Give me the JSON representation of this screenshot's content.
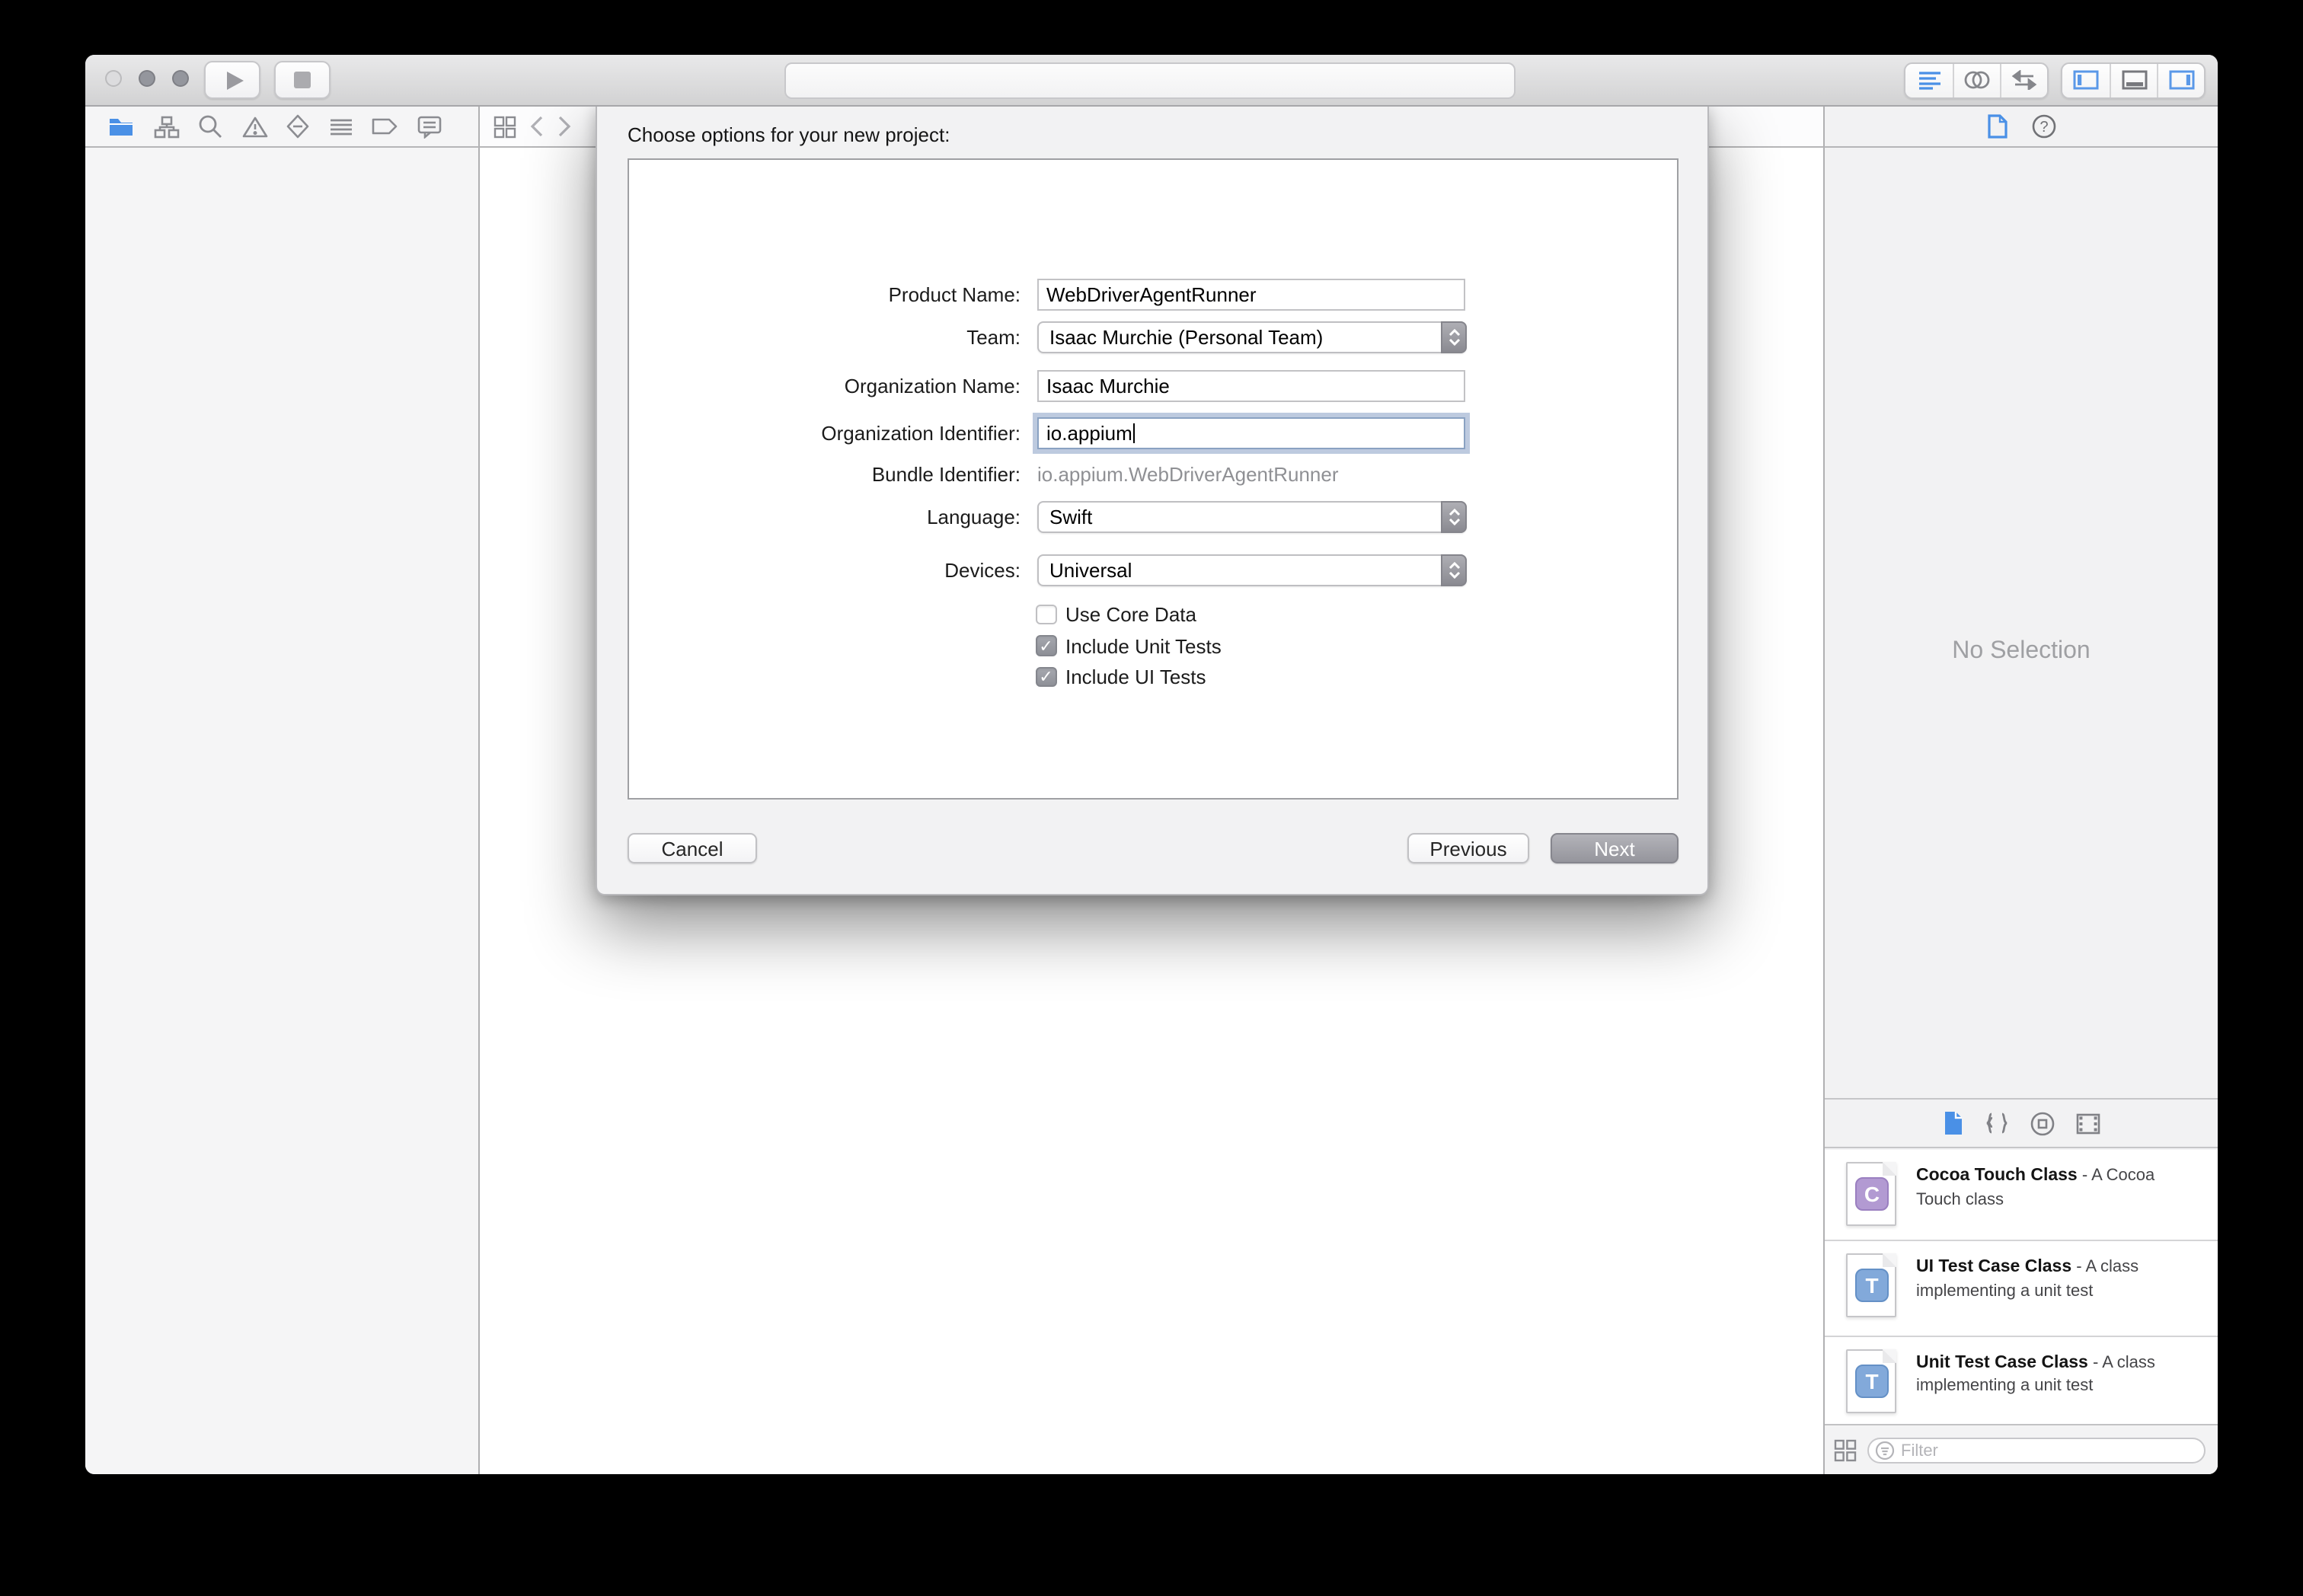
{
  "toolbar": {
    "traffic_lights": [
      "close",
      "minimize",
      "zoom"
    ],
    "run_controls": [
      "play",
      "stop"
    ],
    "activity_text": "",
    "editor_modes": [
      "standard-editor",
      "assistant-editor",
      "version-editor"
    ],
    "view_toggles": [
      "navigator-panel",
      "debug-area",
      "utilities-panel"
    ]
  },
  "navigator_bar": {
    "icons": [
      "project-navigator",
      "symbol-navigator",
      "search-navigator",
      "issue-navigator",
      "test-navigator",
      "debug-navigator",
      "breakpoint-navigator",
      "report-navigator"
    ],
    "editor_icons": [
      "related-items",
      "back",
      "forward"
    ]
  },
  "inspector_bar": {
    "icons": [
      "file-inspector",
      "quick-help"
    ]
  },
  "dialog": {
    "title": "Choose options for your new project:",
    "rows": [
      {
        "type": "text",
        "label": "Product Name:",
        "value": "WebDriverAgentRunner"
      },
      {
        "type": "popup",
        "label": "Team:",
        "value": "Isaac Murchie (Personal Team)"
      },
      {
        "type": "text",
        "label": "Organization Name:",
        "value": "Isaac Murchie"
      },
      {
        "type": "text",
        "label": "Organization Identifier:",
        "value": "io.appium",
        "focused": true
      },
      {
        "type": "static",
        "label": "Bundle Identifier:",
        "value": "io.appium.WebDriverAgentRunner"
      },
      {
        "type": "popup",
        "label": "Language:",
        "value": "Swift"
      },
      {
        "type": "popup",
        "label": "Devices:",
        "value": "Universal"
      }
    ],
    "checkboxes": [
      {
        "label": "Use Core Data",
        "checked": false
      },
      {
        "label": "Include Unit Tests",
        "checked": true
      },
      {
        "label": "Include UI Tests",
        "checked": true
      }
    ],
    "buttons": {
      "cancel": "Cancel",
      "previous": "Previous",
      "next": "Next"
    }
  },
  "sidebar": {
    "no_selection": "No Selection",
    "library_tabs": [
      "file-templates",
      "code-snippets",
      "object-library",
      "media-library"
    ],
    "library": [
      {
        "name": "Cocoa Touch Class",
        "sep": " - ",
        "desc": "A Cocoa Touch class",
        "letter": "C",
        "badge_color": "#b29ad2"
      },
      {
        "name": "UI Test Case Class",
        "sep": " - ",
        "desc": "A class implementing a unit test",
        "letter": "T",
        "badge_color": "#82a9da"
      },
      {
        "name": "Unit Test Case Class",
        "sep": " - ",
        "desc": "A class implementing a unit test",
        "letter": "T",
        "badge_color": "#82a9da"
      }
    ],
    "filter_placeholder": "Filter"
  },
  "colors": {
    "accent_blue": "#4a90e6",
    "inactive_control_gray": "#95959c",
    "window_chrome": "#d2d2d3",
    "focus_ring": "rgba(134,159,196,0.55)"
  }
}
